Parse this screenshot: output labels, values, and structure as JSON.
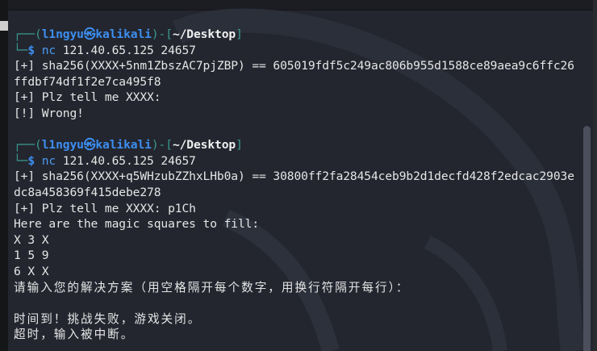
{
  "terminal": {
    "sessions": [
      {
        "user": "l1ngyu",
        "at_symbol": "㉿",
        "host": "kalikali",
        "cwd": "~/Desktop",
        "command": "nc",
        "args": " 121.40.65.125 24657",
        "output": [
          "[+] sha256(XXXX+5nm1ZbszAC7pjZBP) == 605019fdf5c249ac806b955d1588ce89aea9c6ffc26",
          "ffdbf74df1f2e7ca495f8",
          "[+] Plz tell me XXXX:",
          "[!] Wrong!"
        ]
      },
      {
        "user": "l1ngyu",
        "at_symbol": "㉿",
        "host": "kalikali",
        "cwd": "~/Desktop",
        "command": "nc",
        "args": " 121.40.65.125 24657",
        "output": [
          "[+] sha256(XXXX+q5WHzubZZhxLHb0a) == 30800ff2fa28454ceb9b2d1decfd428f2edcac2903e",
          "dc8a458369f415debe278",
          "[+] Plz tell me XXXX: p1Ch",
          "Here are the magic squares to fill:",
          "X 3 X",
          "1 5 9",
          "6 X X"
        ],
        "cjk_output": [
          "请输入您的解决方案（用空格隔开每个数字，用换行符隔开每行）：",
          "",
          "时间到！挑战失败，游戏关闭。",
          "超时，输入被中断。"
        ]
      }
    ]
  },
  "colors": {
    "background": "#23262f",
    "prompt_frame": "#3a9a8f",
    "user_host": "#3d8ef0",
    "text": "#e6e6e6"
  }
}
